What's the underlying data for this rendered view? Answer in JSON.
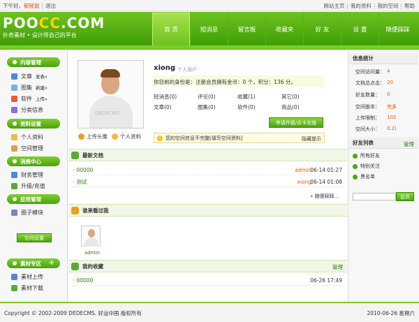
{
  "topbar": {
    "greeting": "下午好，",
    "username": "郁郁鼠",
    "logout": "退出",
    "site_home": "网站主页",
    "my_profile": "我的资料",
    "my_space": "我的空间",
    "help": "帮助"
  },
  "header": {
    "logo_a": "POO",
    "logo_b": "CC",
    "logo_c": ".COM",
    "slogan": "扑奇素材 • 设计师自己的平台",
    "nav": [
      "首 页",
      "短消息",
      "留言板",
      "收藏夹",
      "好 友",
      "设 置",
      "随便踩踩"
    ]
  },
  "sidebar": {
    "sections": [
      {
        "title": "内容管理",
        "items": [
          {
            "label": "文章",
            "sub": "发表»"
          },
          {
            "label": "图集",
            "sub": "新建»"
          },
          {
            "label": "软件",
            "sub": "上传»"
          },
          {
            "label": "分类信息",
            "sub": ""
          }
        ]
      },
      {
        "title": "资料设置",
        "items": [
          {
            "label": "个人资料",
            "sub": ""
          },
          {
            "label": "空间管理",
            "sub": ""
          }
        ]
      },
      {
        "title": "消费中心",
        "items": [
          {
            "label": "财务管理",
            "sub": ""
          },
          {
            "label": "升级/充值",
            "sub": ""
          }
        ]
      },
      {
        "title": "应用管理",
        "items": [
          {
            "label": "圈子模块",
            "sub": ""
          }
        ]
      }
    ],
    "space_settings_btn": "空间设置",
    "material_section": {
      "title": "素材专区",
      "plus": "+",
      "items": [
        "素材上传",
        "素材下载"
      ]
    }
  },
  "profile": {
    "watermark": "DEDECMS",
    "upload_avatar": "上传头像",
    "personal_info": "个人资料",
    "name": "xiong",
    "user_type": "个人用户",
    "identity_line": "你目前的身份是：注册会员拥有金币：0 个，积分：136 分。",
    "stats": [
      [
        "短消息(0)",
        "评论(0)",
        "收藏(1)",
        "其它(0)"
      ],
      [
        "文章(0)",
        "图集(0)",
        "软件(0)",
        "商品(0)"
      ]
    ],
    "apply_btn": "申请升级/点卡充值",
    "notice": "您的空间信息不完整[填写空间资料]",
    "notice_hide": "隐藏提示"
  },
  "latest_docs": {
    "title": "最新文档",
    "rows": [
      {
        "title": "00000",
        "author": "admin",
        "date": "06-14 01:27"
      },
      {
        "title": "测试",
        "author": "xiong",
        "date": "06-14 01:08"
      }
    ],
    "more": "» 随便踩踩..."
  },
  "visitors": {
    "title": "谁来看过我",
    "list": [
      "admin"
    ]
  },
  "favorites": {
    "title": "我的收藏",
    "manage": "管理",
    "rows": [
      {
        "title": "00000",
        "date": "06-26 17:49"
      }
    ]
  },
  "info_stats": {
    "title": "信息统计",
    "rows": [
      {
        "label": "空间访问量：",
        "value": "4"
      },
      {
        "label": "文档总点击：",
        "value": "20"
      },
      {
        "label": "好友数量：",
        "value": "0"
      },
      {
        "label": "空间版本：",
        "value": "完多"
      },
      {
        "label": "上传限制：",
        "value": "102"
      },
      {
        "label": "空间大小：",
        "value": "0.2("
      }
    ]
  },
  "friends": {
    "title": "好友列表",
    "manage": "管理",
    "items": [
      "所有好友",
      "特别关注",
      "黑名单"
    ],
    "find_btn": "会员"
  },
  "footer": {
    "copyright": "Copyright © 2002-2009 DEDECMS. 好运中国 版权所有",
    "date": "2010-06-26 星期六"
  },
  "colors": {
    "brand_green": "#4da50f",
    "accent_orange": "#e05a00"
  }
}
